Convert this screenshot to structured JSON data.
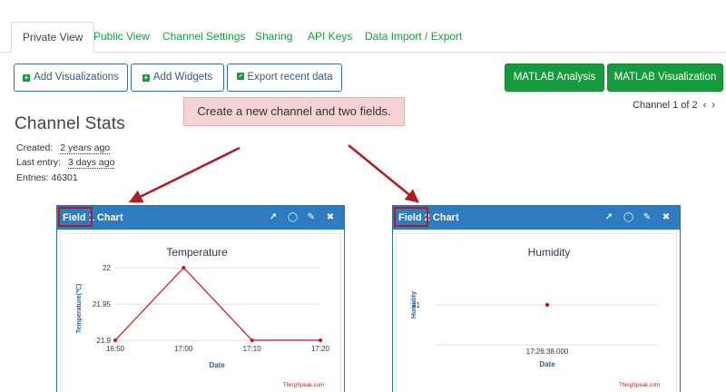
{
  "tabs": [
    {
      "label": "Private View",
      "active": true
    },
    {
      "label": "Public View"
    },
    {
      "label": "Channel Settings"
    },
    {
      "label": "Sharing"
    },
    {
      "label": "API Keys"
    },
    {
      "label": "Data Import / Export"
    }
  ],
  "toolbar": {
    "add_visualizations": "Add Visualizations",
    "add_widgets": "Add Widgets",
    "export_recent_data": "Export recent data",
    "matlab_analysis": "MATLAB Analysis",
    "matlab_visualization": "MATLAB Visualization"
  },
  "pager": {
    "label": "Channel 1 of 2"
  },
  "stats": {
    "title": "Channel Stats",
    "created_label": "Created:",
    "created_value": "2 years ago",
    "last_entry_label": "Last entry:",
    "last_entry_value": "3 days ago",
    "entries_label": "Entries:",
    "entries_value": "46301"
  },
  "callout": {
    "text": "Create a new channel and two fields."
  },
  "widgets": [
    {
      "field": "Field 1",
      "rest": " Chart"
    },
    {
      "field": "Field 2",
      "rest": " Chart"
    }
  ],
  "colors": {
    "accent_green": "#169a3d",
    "header_blue": "#2f7bbf",
    "series_red": "#cc1111",
    "annotation_red": "#b01c22"
  },
  "chart_data": [
    {
      "type": "line",
      "title": "Temperature",
      "xlabel": "Date",
      "ylabel": "Temperature(℃)",
      "x_ticks": [
        "16:50",
        "17:00",
        "17:10",
        "17:20"
      ],
      "y_ticks": [
        "22",
        "21.95",
        "21.9"
      ],
      "ylim": [
        21.9,
        22
      ],
      "series": [
        {
          "x": [
            "16:50",
            "17:00",
            "17:10",
            "17:20"
          ],
          "values": [
            21.9,
            22,
            21.9,
            21.9
          ]
        }
      ],
      "credit": "ThingSpeak.com"
    },
    {
      "type": "scatter",
      "title": "Humidity",
      "xlabel": "Date",
      "ylabel": "Humidity",
      "x_ticks": [
        "17:26:38.000"
      ],
      "y_ticks": [
        "41"
      ],
      "series": [
        {
          "x": [
            "17:26:38.000"
          ],
          "values": [
            41
          ]
        }
      ],
      "credit": "ThingSpeak.com"
    }
  ]
}
